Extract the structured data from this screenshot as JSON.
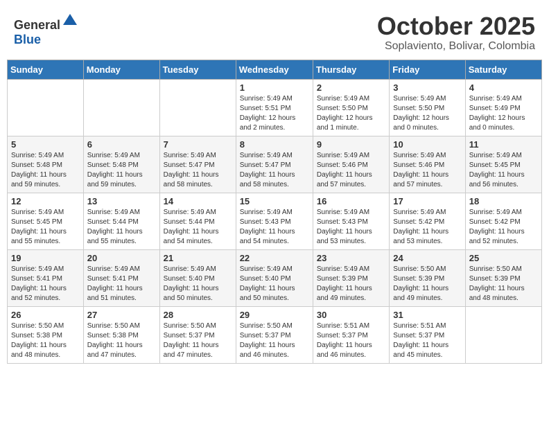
{
  "header": {
    "logo_general": "General",
    "logo_blue": "Blue",
    "month": "October 2025",
    "location": "Soplaviento, Bolivar, Colombia"
  },
  "weekdays": [
    "Sunday",
    "Monday",
    "Tuesday",
    "Wednesday",
    "Thursday",
    "Friday",
    "Saturday"
  ],
  "weeks": [
    [
      {
        "day": "",
        "info": ""
      },
      {
        "day": "",
        "info": ""
      },
      {
        "day": "",
        "info": ""
      },
      {
        "day": "1",
        "info": "Sunrise: 5:49 AM\nSunset: 5:51 PM\nDaylight: 12 hours\nand 2 minutes."
      },
      {
        "day": "2",
        "info": "Sunrise: 5:49 AM\nSunset: 5:50 PM\nDaylight: 12 hours\nand 1 minute."
      },
      {
        "day": "3",
        "info": "Sunrise: 5:49 AM\nSunset: 5:50 PM\nDaylight: 12 hours\nand 0 minutes."
      },
      {
        "day": "4",
        "info": "Sunrise: 5:49 AM\nSunset: 5:49 PM\nDaylight: 12 hours\nand 0 minutes."
      }
    ],
    [
      {
        "day": "5",
        "info": "Sunrise: 5:49 AM\nSunset: 5:48 PM\nDaylight: 11 hours\nand 59 minutes."
      },
      {
        "day": "6",
        "info": "Sunrise: 5:49 AM\nSunset: 5:48 PM\nDaylight: 11 hours\nand 59 minutes."
      },
      {
        "day": "7",
        "info": "Sunrise: 5:49 AM\nSunset: 5:47 PM\nDaylight: 11 hours\nand 58 minutes."
      },
      {
        "day": "8",
        "info": "Sunrise: 5:49 AM\nSunset: 5:47 PM\nDaylight: 11 hours\nand 58 minutes."
      },
      {
        "day": "9",
        "info": "Sunrise: 5:49 AM\nSunset: 5:46 PM\nDaylight: 11 hours\nand 57 minutes."
      },
      {
        "day": "10",
        "info": "Sunrise: 5:49 AM\nSunset: 5:46 PM\nDaylight: 11 hours\nand 57 minutes."
      },
      {
        "day": "11",
        "info": "Sunrise: 5:49 AM\nSunset: 5:45 PM\nDaylight: 11 hours\nand 56 minutes."
      }
    ],
    [
      {
        "day": "12",
        "info": "Sunrise: 5:49 AM\nSunset: 5:45 PM\nDaylight: 11 hours\nand 55 minutes."
      },
      {
        "day": "13",
        "info": "Sunrise: 5:49 AM\nSunset: 5:44 PM\nDaylight: 11 hours\nand 55 minutes."
      },
      {
        "day": "14",
        "info": "Sunrise: 5:49 AM\nSunset: 5:44 PM\nDaylight: 11 hours\nand 54 minutes."
      },
      {
        "day": "15",
        "info": "Sunrise: 5:49 AM\nSunset: 5:43 PM\nDaylight: 11 hours\nand 54 minutes."
      },
      {
        "day": "16",
        "info": "Sunrise: 5:49 AM\nSunset: 5:43 PM\nDaylight: 11 hours\nand 53 minutes."
      },
      {
        "day": "17",
        "info": "Sunrise: 5:49 AM\nSunset: 5:42 PM\nDaylight: 11 hours\nand 53 minutes."
      },
      {
        "day": "18",
        "info": "Sunrise: 5:49 AM\nSunset: 5:42 PM\nDaylight: 11 hours\nand 52 minutes."
      }
    ],
    [
      {
        "day": "19",
        "info": "Sunrise: 5:49 AM\nSunset: 5:41 PM\nDaylight: 11 hours\nand 52 minutes."
      },
      {
        "day": "20",
        "info": "Sunrise: 5:49 AM\nSunset: 5:41 PM\nDaylight: 11 hours\nand 51 minutes."
      },
      {
        "day": "21",
        "info": "Sunrise: 5:49 AM\nSunset: 5:40 PM\nDaylight: 11 hours\nand 50 minutes."
      },
      {
        "day": "22",
        "info": "Sunrise: 5:49 AM\nSunset: 5:40 PM\nDaylight: 11 hours\nand 50 minutes."
      },
      {
        "day": "23",
        "info": "Sunrise: 5:49 AM\nSunset: 5:39 PM\nDaylight: 11 hours\nand 49 minutes."
      },
      {
        "day": "24",
        "info": "Sunrise: 5:50 AM\nSunset: 5:39 PM\nDaylight: 11 hours\nand 49 minutes."
      },
      {
        "day": "25",
        "info": "Sunrise: 5:50 AM\nSunset: 5:39 PM\nDaylight: 11 hours\nand 48 minutes."
      }
    ],
    [
      {
        "day": "26",
        "info": "Sunrise: 5:50 AM\nSunset: 5:38 PM\nDaylight: 11 hours\nand 48 minutes."
      },
      {
        "day": "27",
        "info": "Sunrise: 5:50 AM\nSunset: 5:38 PM\nDaylight: 11 hours\nand 47 minutes."
      },
      {
        "day": "28",
        "info": "Sunrise: 5:50 AM\nSunset: 5:37 PM\nDaylight: 11 hours\nand 47 minutes."
      },
      {
        "day": "29",
        "info": "Sunrise: 5:50 AM\nSunset: 5:37 PM\nDaylight: 11 hours\nand 46 minutes."
      },
      {
        "day": "30",
        "info": "Sunrise: 5:51 AM\nSunset: 5:37 PM\nDaylight: 11 hours\nand 46 minutes."
      },
      {
        "day": "31",
        "info": "Sunrise: 5:51 AM\nSunset: 5:37 PM\nDaylight: 11 hours\nand 45 minutes."
      },
      {
        "day": "",
        "info": ""
      }
    ]
  ]
}
